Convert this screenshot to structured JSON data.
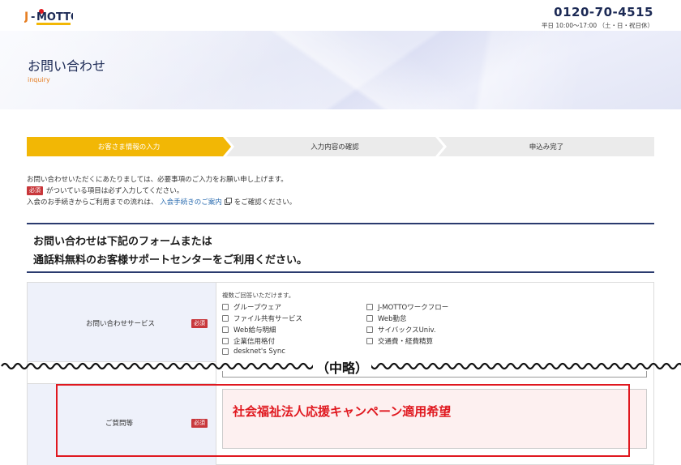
{
  "header": {
    "logo_text": "J-MOTTO",
    "phone": "0120-70-4515",
    "hours": "平日 10:00～17:00 （土・日・祝日休）"
  },
  "hero": {
    "title": "お問い合わせ",
    "subtitle": "inquiry"
  },
  "steps": [
    {
      "label": "お客さま情報の入力",
      "active": true
    },
    {
      "label": "入力内容の確認",
      "active": false
    },
    {
      "label": "申込み完了",
      "active": false
    }
  ],
  "intro": {
    "line1": "お問い合わせいただくにあたりましては、必要事項のご入力をお願い申し上げます。",
    "required_badge": "必須",
    "line2": "がついている項目は必ず入力してください。",
    "line3_prefix": "入会のお手続きからご利用までの流れは、",
    "line3_link": "入会手続きのご案内",
    "line3_suffix": "をご確認ください。"
  },
  "notice": {
    "line1": "お問い合わせは下記のフォームまたは",
    "line2": "通話料無料のお客様サポートセンターをご利用ください。"
  },
  "form": {
    "service": {
      "label": "お問い合わせサービス",
      "required_badge": "必須",
      "note": "複数ご回答いただけます。",
      "options": [
        {
          "label": "グループウェア",
          "checked": false
        },
        {
          "label": "J-MOTTOワークフロー",
          "checked": false
        },
        {
          "label": "ファイル共有サービス",
          "checked": false
        },
        {
          "label": "Web勤怠",
          "checked": false
        },
        {
          "label": "Web給与明細",
          "checked": false
        },
        {
          "label": "サイバックスUniv.",
          "checked": false
        },
        {
          "label": "企業信用格付",
          "checked": false
        },
        {
          "label": "交通費・経費精算",
          "checked": false
        },
        {
          "label": "desknet's Sync",
          "checked": false
        }
      ]
    },
    "omission": "（中略）",
    "question": {
      "label": "ご質問等",
      "required_badge": "必須",
      "value": "社会福祉法人応援キャンペーン適用希望"
    }
  },
  "colors": {
    "brand_navy": "#1c2a55",
    "step_active": "#f2b705",
    "required": "#c8373b",
    "highlight_red": "#e0181f"
  }
}
